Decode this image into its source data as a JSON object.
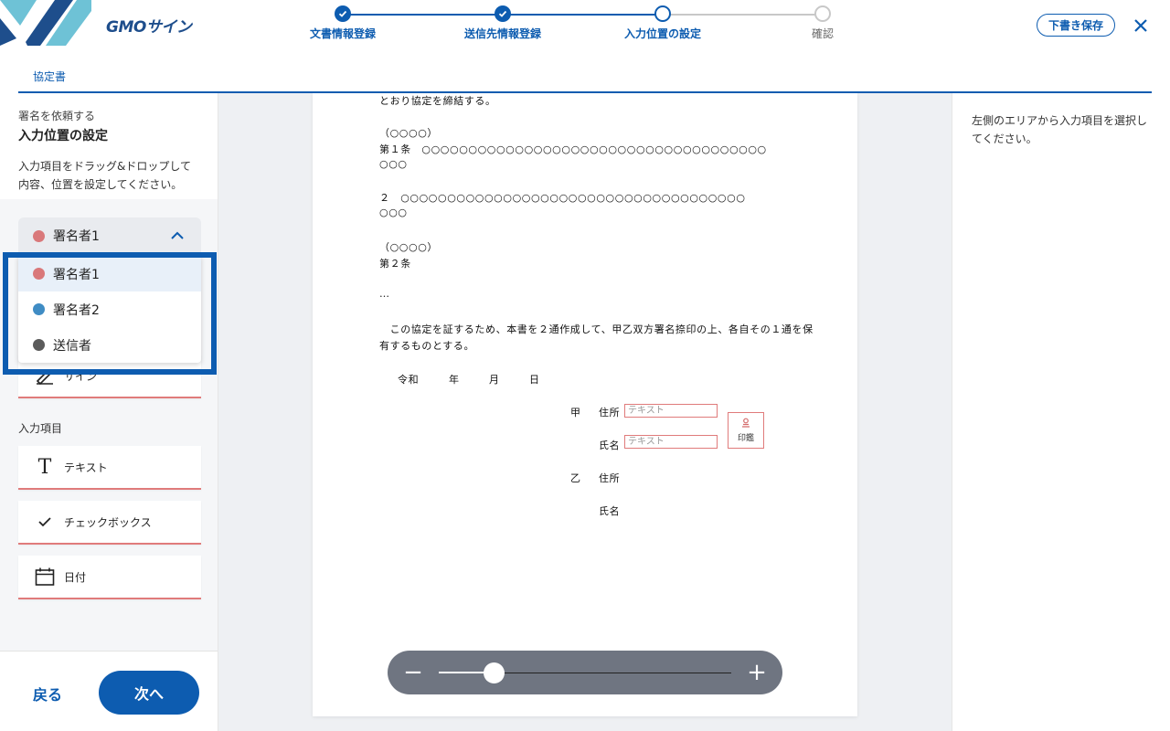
{
  "header": {
    "brand": "GMOサイン",
    "steps": [
      {
        "label": "文書情報登録",
        "state": "done"
      },
      {
        "label": "送信先情報登録",
        "state": "done"
      },
      {
        "label": "入力位置の設定",
        "state": "current"
      },
      {
        "label": "確認",
        "state": "todo"
      }
    ],
    "draft_label": "下書き保存",
    "close_icon": "close-icon"
  },
  "tab": {
    "label": "協定書"
  },
  "left": {
    "subtitle": "署名を依頼する",
    "title": "入力位置の設定",
    "desc_line1": "入力項目をドラッグ&ドロップして",
    "desc_line2": "内容、位置を設定してください。",
    "selected_signer": "署名者1",
    "signer_options": [
      {
        "label": "署名者1",
        "color": "#d9787a"
      },
      {
        "label": "署名者2",
        "color": "#3f8cc4"
      },
      {
        "label": "送信者",
        "color": "#5b5b5b"
      }
    ],
    "sign_item": "サイン",
    "input_section": "入力項目",
    "input_items": [
      {
        "label": "テキスト",
        "icon": "text-icon"
      },
      {
        "label": "チェックボックス",
        "icon": "check-icon"
      },
      {
        "label": "日付",
        "icon": "calendar-icon"
      }
    ],
    "back": "戻る",
    "next": "次へ"
  },
  "document": {
    "lines": [
      "とおり協定を締結する。",
      "（○○○○）",
      "第１条　○○○○○○○○○○○○○○○○○○○○○○○○○○○○○○○○○○○○○",
      "○○○",
      "２　○○○○○○○○○○○○○○○○○○○○○○○○○○○○○○○○○○○○○",
      "○○○",
      "（○○○○）",
      "第２条",
      "…",
      "　この協定を証するため、本書を２通作成して、甲乙双方署名捺印の上、各自その１通を保",
      "有するものとする。"
    ],
    "date_reiwa": "令和",
    "date_year": "年",
    "date_month": "月",
    "date_day": "日",
    "party_a": "甲",
    "party_b": "乙",
    "address": "住所",
    "name": "氏名",
    "text_placeholder": "テキスト",
    "seal_label": "印鑑"
  },
  "zoom": {
    "minus": "−",
    "plus": "+",
    "level": 0.2
  },
  "right": {
    "hint": "左側のエリアから入力項目を選択してください。"
  }
}
